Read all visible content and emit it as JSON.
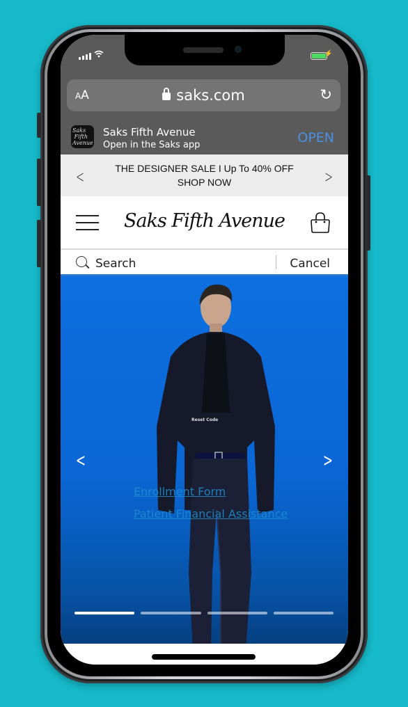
{
  "status_bar": {
    "signal_icon": "cellular-signal-icon",
    "wifi_icon": "wifi-icon",
    "battery_icon": "battery-charging-icon",
    "battery_level": 1.0,
    "colors": {
      "battery": "#4cd964"
    }
  },
  "browser": {
    "text_size_label": "AA",
    "url": "saks.com",
    "lock_icon": "lock-icon",
    "reload_icon": "reload-icon"
  },
  "app_banner": {
    "icon_text": "Saks Fifth Avenue",
    "title": "Saks Fifth Avenue",
    "subtitle": "Open in the Saks app",
    "open_label": "OPEN",
    "colors": {
      "open": "#4a90e2"
    }
  },
  "promo": {
    "line1": "THE DESIGNER SALE I Up To 40% OFF",
    "line2": "SHOP NOW",
    "prev_icon": "chevron-left-icon",
    "next_icon": "chevron-right-icon"
  },
  "header": {
    "menu_icon": "hamburger-menu-icon",
    "logo": "Saks Fifth Avenue",
    "bag_icon": "shopping-bag-icon"
  },
  "search": {
    "placeholder": "Search",
    "cancel_label": "Cancel"
  },
  "hero": {
    "overlay_text": "Reset Code",
    "links": [
      "Enrollment Form",
      "Patient Financial Assistance"
    ],
    "carousel": {
      "slides": 4,
      "active_index": 0
    },
    "colors": {
      "background": "#0d6fe0",
      "link": "#1f8fcf"
    }
  }
}
